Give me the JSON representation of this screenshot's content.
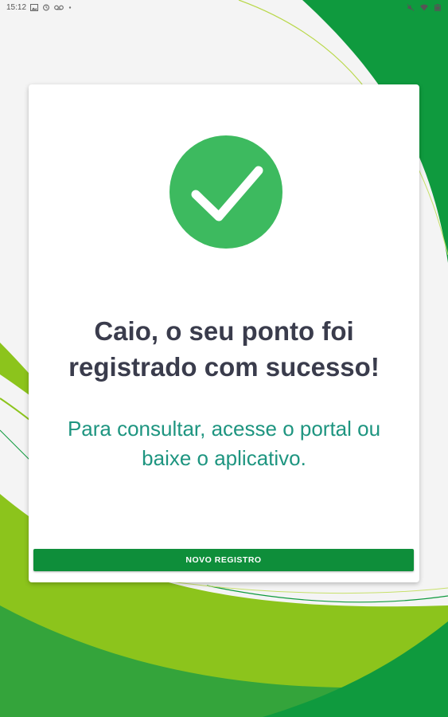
{
  "status_bar": {
    "time": "15:12",
    "left_icons": [
      "image-icon",
      "sync-icon",
      "voicemail-icon",
      "dot-icon"
    ],
    "right_icons": [
      "mute-icon",
      "wifi-icon",
      "battery-icon"
    ]
  },
  "card": {
    "icon": "check-icon",
    "title_line1": "Caio, o seu ponto foi",
    "title_line2": "registrado com sucesso!",
    "subtitle_line1": "Para consultar, acesse o portal ou",
    "subtitle_line2": "baixe o aplicativo.",
    "button_label": "NOVO REGISTRO"
  },
  "colors": {
    "brand_green": "#0e8e3a",
    "check_green": "#3dba5f",
    "title_text": "#3a3c4c",
    "subtitle_teal": "#1e9580",
    "lime": "#8cc41c"
  }
}
